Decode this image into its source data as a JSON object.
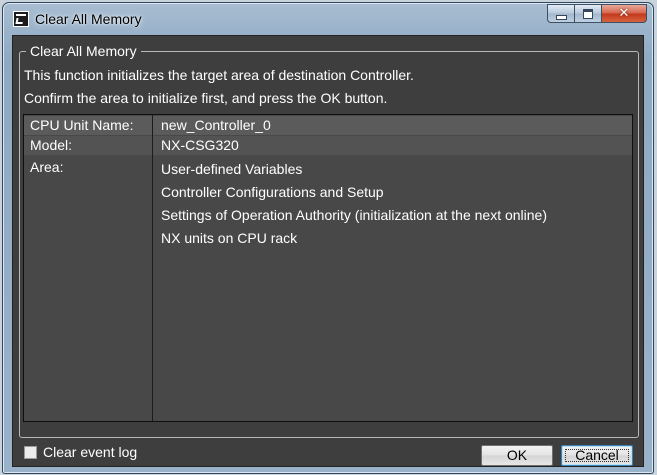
{
  "window": {
    "title": "Clear All Memory",
    "icon": "application-icon",
    "controls": [
      "minimize",
      "maximize",
      "close"
    ],
    "close_glyph": "✕"
  },
  "group": {
    "legend": "Clear All Memory",
    "description_line1": "This function initializes the target area of destination Controller.",
    "description_line2": "Confirm the area to initialize first, and press the OK button."
  },
  "info": {
    "cpu_unit_name_label": "CPU Unit Name:",
    "cpu_unit_name_value": "new_Controller_0",
    "model_label": "Model:",
    "model_value": "NX-CSG320",
    "area_label": "Area:",
    "area_items": [
      "User-defined Variables",
      "Controller Configurations and Setup",
      "Settings of Operation Authority (initialization at the next online)",
      "NX units on CPU rack"
    ]
  },
  "options": {
    "clear_event_log_label": "Clear event log",
    "clear_event_log_checked": false
  },
  "buttons": {
    "ok_label": "OK",
    "cancel_label": "Cancel"
  },
  "colors": {
    "client_background": "#3e3e3e",
    "close_button": "#c2381c"
  }
}
